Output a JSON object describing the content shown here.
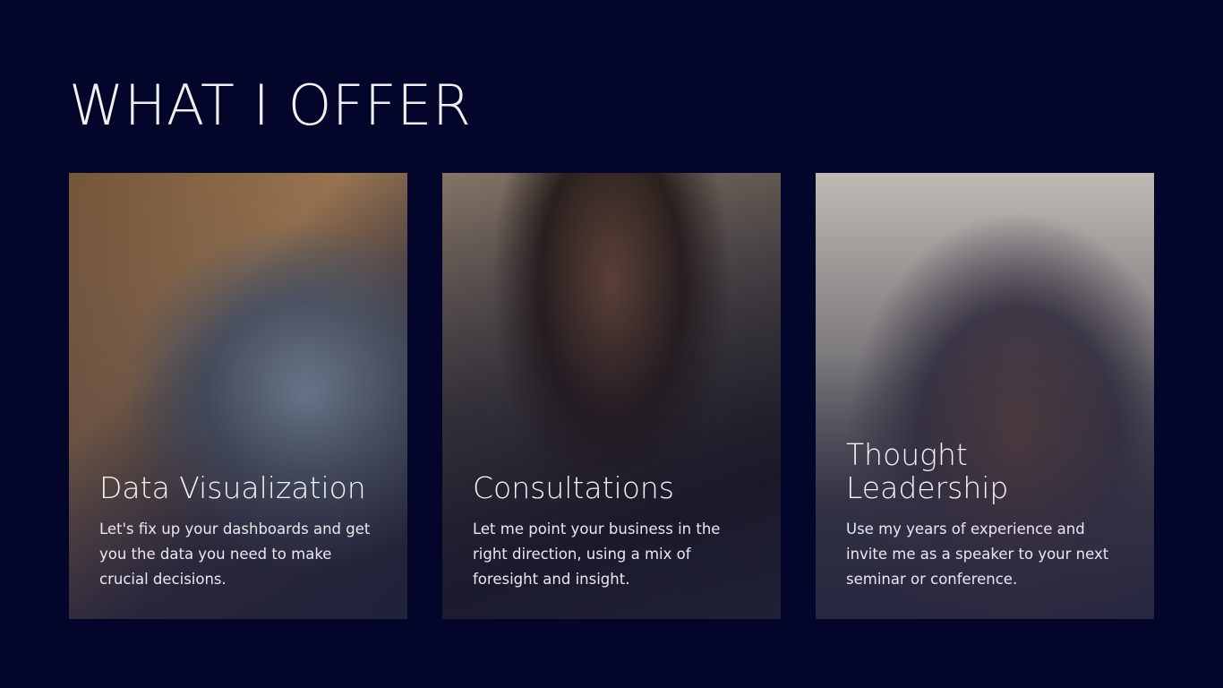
{
  "header": {
    "title": "WHAT I OFFER"
  },
  "cards": [
    {
      "title": "Data Visualization",
      "description": "Let's fix up your dashboards and get you the data you need to make crucial decisions."
    },
    {
      "title": "Consultations",
      "description": "Let me point your business in the right direction, using a mix of foresight and insight."
    },
    {
      "title": "Thought Leadership",
      "description": "Use my years of experience and invite me as a speaker to your next seminar or conference."
    }
  ],
  "colors": {
    "background": "#04052b",
    "text": "#f2f2f2"
  }
}
